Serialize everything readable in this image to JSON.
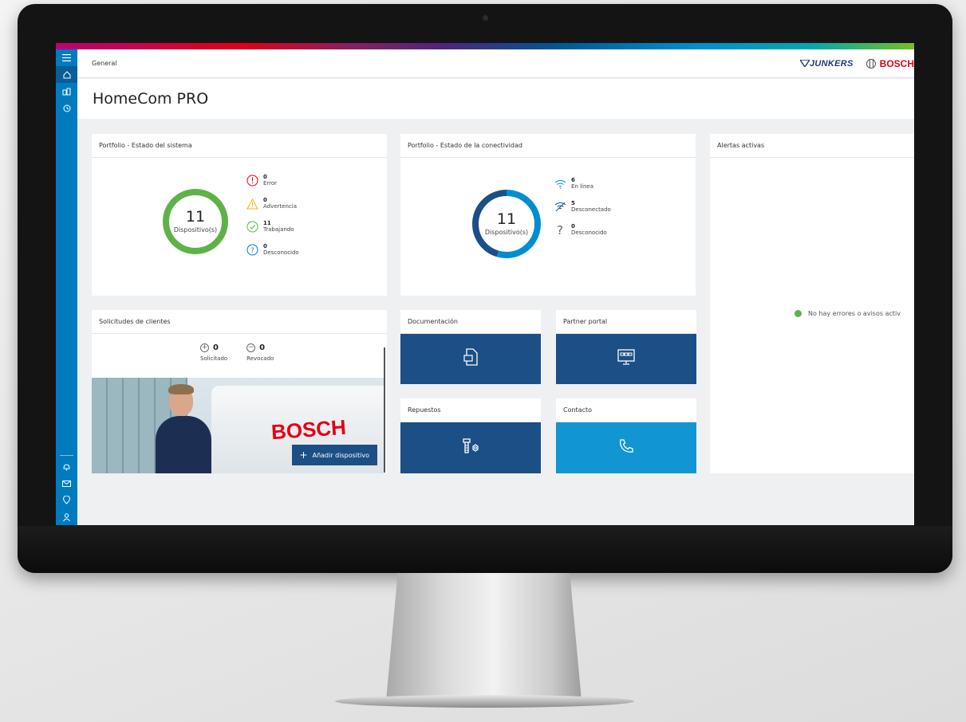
{
  "app": {
    "breadcrumb": "General",
    "title": "HomeCom PRO",
    "brand_logos": [
      "JUNKERS",
      "BOSCH"
    ]
  },
  "sidebar": {
    "top_items": [
      {
        "icon": "menu-icon"
      },
      {
        "icon": "home-icon"
      },
      {
        "icon": "devices-icon"
      },
      {
        "icon": "history-icon"
      }
    ],
    "bottom_items": [
      {
        "icon": "bell-icon"
      },
      {
        "icon": "mail-icon"
      },
      {
        "icon": "location-icon"
      },
      {
        "icon": "user-icon"
      }
    ]
  },
  "system_status": {
    "header": "Portfolio - Estado del sistema",
    "total": "11",
    "total_label": "Dispositivo(s)",
    "items": [
      {
        "value": "0",
        "label": "Error",
        "color": "#e20015"
      },
      {
        "value": "0",
        "label": "Advertencia",
        "color": "#f0b400"
      },
      {
        "value": "11",
        "label": "Trabajando",
        "color": "#5fb249"
      },
      {
        "value": "0",
        "label": "Desconocido",
        "color": "#007bc0"
      }
    ]
  },
  "connectivity": {
    "header": "Portfolio - Estado de la conectividad",
    "total": "11",
    "total_label": "Dispositivo(s)",
    "items": [
      {
        "value": "6",
        "label": "En línea",
        "color": "#008ecf"
      },
      {
        "value": "5",
        "label": "Desconectado",
        "color": "#1b4f86"
      },
      {
        "value": "0",
        "label": "Desconocido",
        "color": "#666666"
      }
    ]
  },
  "alerts": {
    "header": "Alertas activas",
    "message": "No hay errores o avisos activ"
  },
  "requests": {
    "header": "Solicitudes de clientes",
    "requested_value": "0",
    "requested_label": "Solicitado",
    "revoked_value": "0",
    "revoked_label": "Revocado",
    "photo_brand": "BOSCH",
    "add_button": "Añadir dispositivo"
  },
  "tiles": {
    "documentation": {
      "header": "Documentación",
      "icon": "document-icon",
      "color": "#1b4f86"
    },
    "partner_portal": {
      "header": "Partner portal",
      "icon": "monitor-icon",
      "color": "#1b4f86"
    },
    "spare_parts": {
      "header": "Repuestos",
      "icon": "screw-nut-icon",
      "color": "#1b4f86"
    },
    "contact": {
      "header": "Contacto",
      "icon": "phone-icon",
      "color": "#1296d3"
    }
  }
}
